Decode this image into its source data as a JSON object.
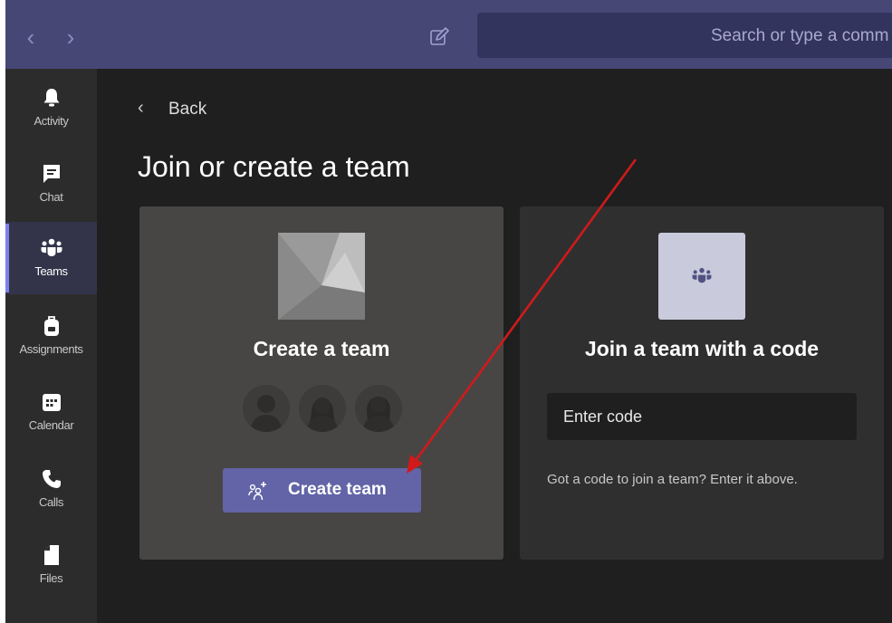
{
  "topbar": {
    "back_icon": "chevron-left-icon",
    "forward_icon": "chevron-right-icon",
    "compose_icon": "compose-icon",
    "search_placeholder": "Search or type a comm"
  },
  "sidebar": {
    "items": [
      {
        "label": "Activity",
        "icon": "bell-icon",
        "active": false
      },
      {
        "label": "Chat",
        "icon": "chat-icon",
        "active": false
      },
      {
        "label": "Teams",
        "icon": "teams-icon",
        "active": true
      },
      {
        "label": "Assignments",
        "icon": "backpack-icon",
        "active": false
      },
      {
        "label": "Calendar",
        "icon": "calendar-icon",
        "active": false
      },
      {
        "label": "Calls",
        "icon": "phone-icon",
        "active": false
      },
      {
        "label": "Files",
        "icon": "file-icon",
        "active": false
      }
    ]
  },
  "main": {
    "back_label": "Back",
    "title": "Join or create a team",
    "create_card": {
      "title": "Create a team",
      "button_label": "Create team"
    },
    "join_card": {
      "title": "Join a team with a code",
      "input_placeholder": "Enter code",
      "hint": "Got a code to join a team? Enter it above."
    }
  },
  "colors": {
    "topbar": "#464775",
    "accent": "#6264a7",
    "annotation_arrow": "#d11a1a"
  }
}
